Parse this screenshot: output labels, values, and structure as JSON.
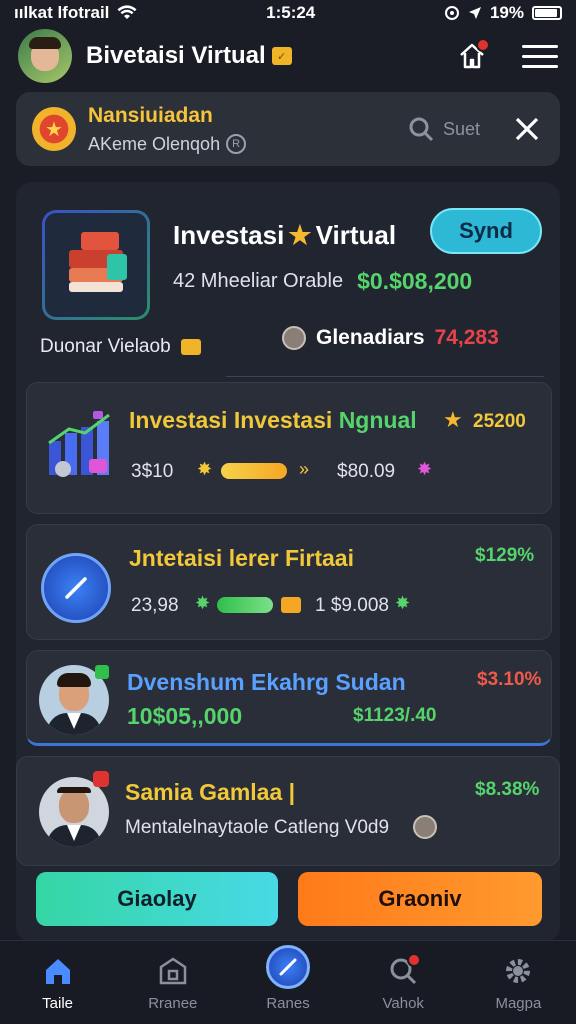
{
  "status": {
    "carrier": "ıılkat lfotrail",
    "time": "1:5:24",
    "battery": "19%"
  },
  "appbar": {
    "title": "Bivetaisi Virtual"
  },
  "notice": {
    "title": "Nansiuiadan",
    "subtitle": "AKeme Olenqoh",
    "search_label": "Suet"
  },
  "hero": {
    "title_part1": "Investasi",
    "title_part2": "Virtual",
    "button": "Synd",
    "count_text": "42 Mheeliar Orable",
    "amount": "$0.$08,200",
    "caption": "Duonar Vielaob",
    "right_label": "Glenadiars",
    "right_value": "74,283"
  },
  "card1": {
    "title_a": "Investasi Investasi",
    "title_b": "Ngnual",
    "value": "25200",
    "left_num": "3$10",
    "right_num": "$80.09"
  },
  "card2": {
    "title": "Jntetaisi lerer Firtaai",
    "pct": "$129%",
    "left_num": "23,98",
    "right_num": "1 $9.008"
  },
  "card3": {
    "title": "Dvenshum Ekahrg Sudan",
    "pct": "$3.10%",
    "amount": "10$05,,000",
    "right_amount": "$1123/.40"
  },
  "card4": {
    "title": "Samia Gamlaa |",
    "pct": "$8.38%",
    "sub": "Mentalelnaytaole Catleng V0d9"
  },
  "buttons": {
    "left": "Giaolay",
    "right": "Graoniv"
  },
  "colors": {
    "accent_cyan": "#2db8d6",
    "accent_green": "#56d46c",
    "accent_orange": "#ff7a1a",
    "bg": "#1a1d26"
  },
  "tabs": [
    {
      "label": "Taile",
      "icon": "home-icon"
    },
    {
      "label": "Rranee",
      "icon": "bank-icon"
    },
    {
      "label": "Ranes",
      "icon": "compose-icon"
    },
    {
      "label": "Vahok",
      "icon": "search-icon"
    },
    {
      "label": "Magpa",
      "icon": "gear-icon"
    }
  ]
}
